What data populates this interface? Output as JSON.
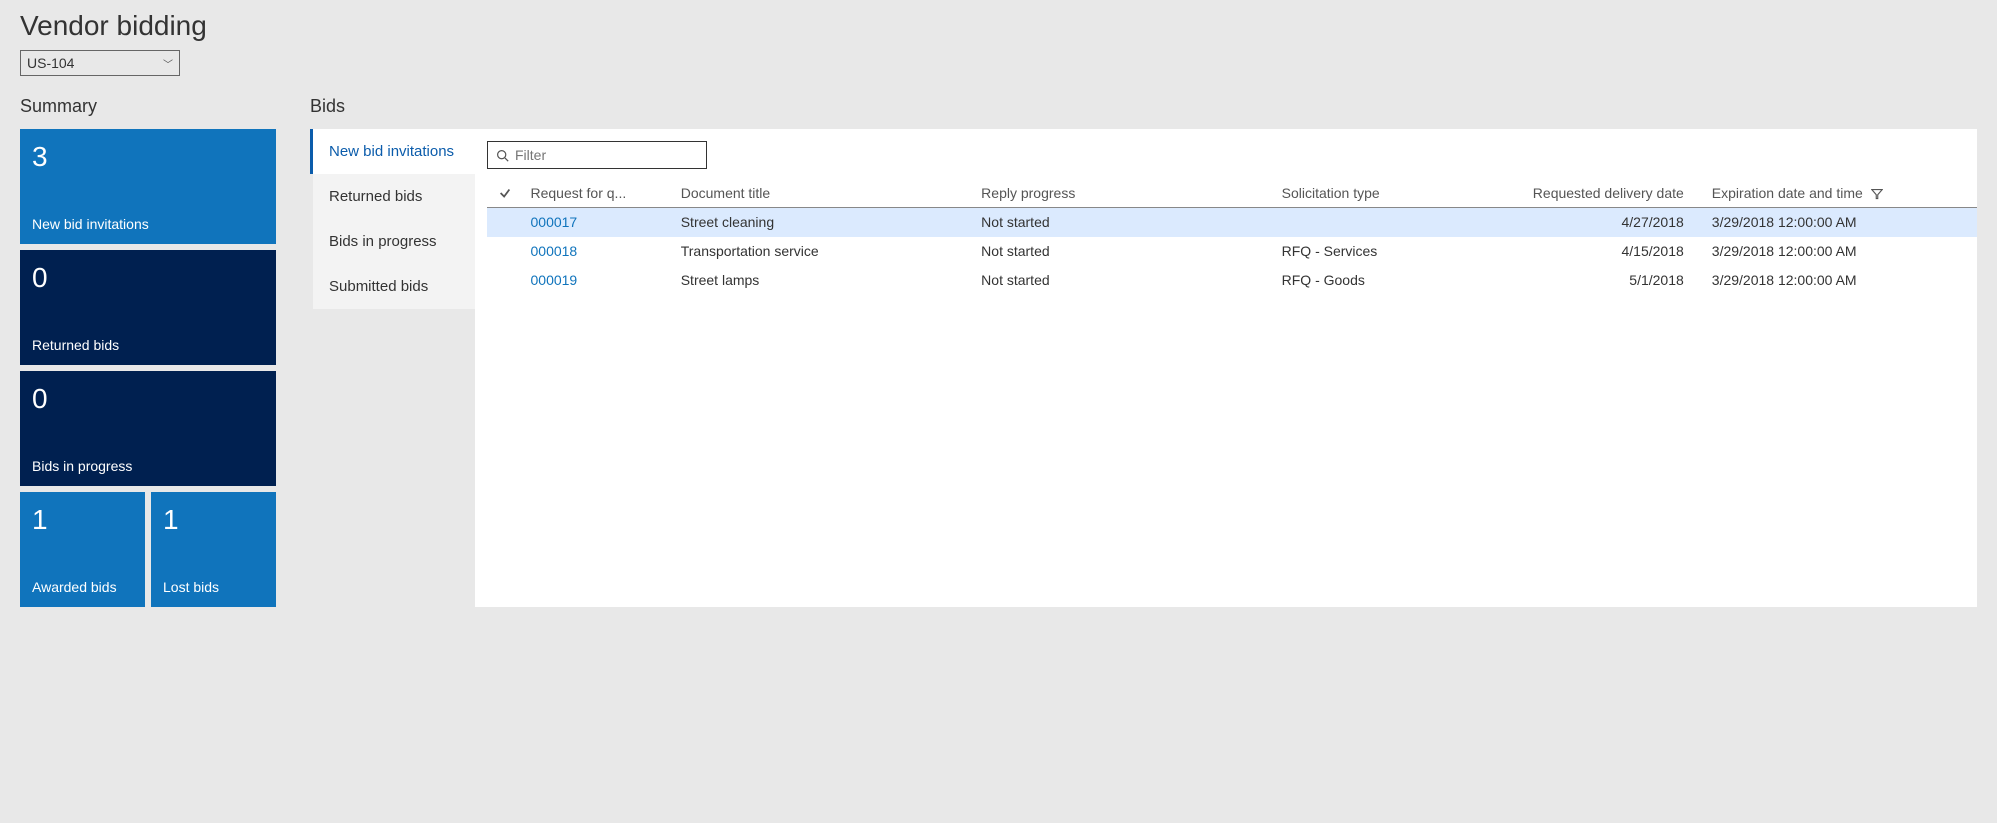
{
  "page": {
    "title": "Vendor bidding",
    "dropdown_value": "US-104"
  },
  "summary": {
    "title": "Summary",
    "tiles": [
      {
        "count": "3",
        "label": "New bid invitations",
        "size": "wide",
        "color": "blue"
      },
      {
        "count": "0",
        "label": "Returned bids",
        "size": "wide",
        "color": "dark"
      },
      {
        "count": "0",
        "label": "Bids in progress",
        "size": "wide",
        "color": "dark"
      },
      {
        "count": "1",
        "label": "Awarded bids",
        "size": "small",
        "color": "blue"
      },
      {
        "count": "1",
        "label": "Lost bids",
        "size": "small",
        "color": "blue"
      }
    ]
  },
  "bids": {
    "title": "Bids",
    "side_items": [
      {
        "label": "New bid invitations",
        "active": true
      },
      {
        "label": "Returned bids",
        "active": false
      },
      {
        "label": "Bids in progress",
        "active": false
      },
      {
        "label": "Submitted bids",
        "active": false
      }
    ],
    "filter_placeholder": "Filter",
    "columns": [
      "Request for q...",
      "Document title",
      "Reply progress",
      "Solicitation type",
      "Requested delivery date",
      "Expiration date and time"
    ],
    "rows": [
      {
        "selected": true,
        "req": "000017",
        "title": "Street cleaning",
        "reply": "Not started",
        "sol": "",
        "date": "4/27/2018",
        "exp": "3/29/2018 12:00:00 AM"
      },
      {
        "selected": false,
        "req": "000018",
        "title": "Transportation service",
        "reply": "Not started",
        "sol": "RFQ - Services",
        "date": "4/15/2018",
        "exp": "3/29/2018 12:00:00 AM"
      },
      {
        "selected": false,
        "req": "000019",
        "title": "Street lamps",
        "reply": "Not started",
        "sol": "RFQ - Goods",
        "date": "5/1/2018",
        "exp": "3/29/2018 12:00:00 AM"
      }
    ]
  }
}
